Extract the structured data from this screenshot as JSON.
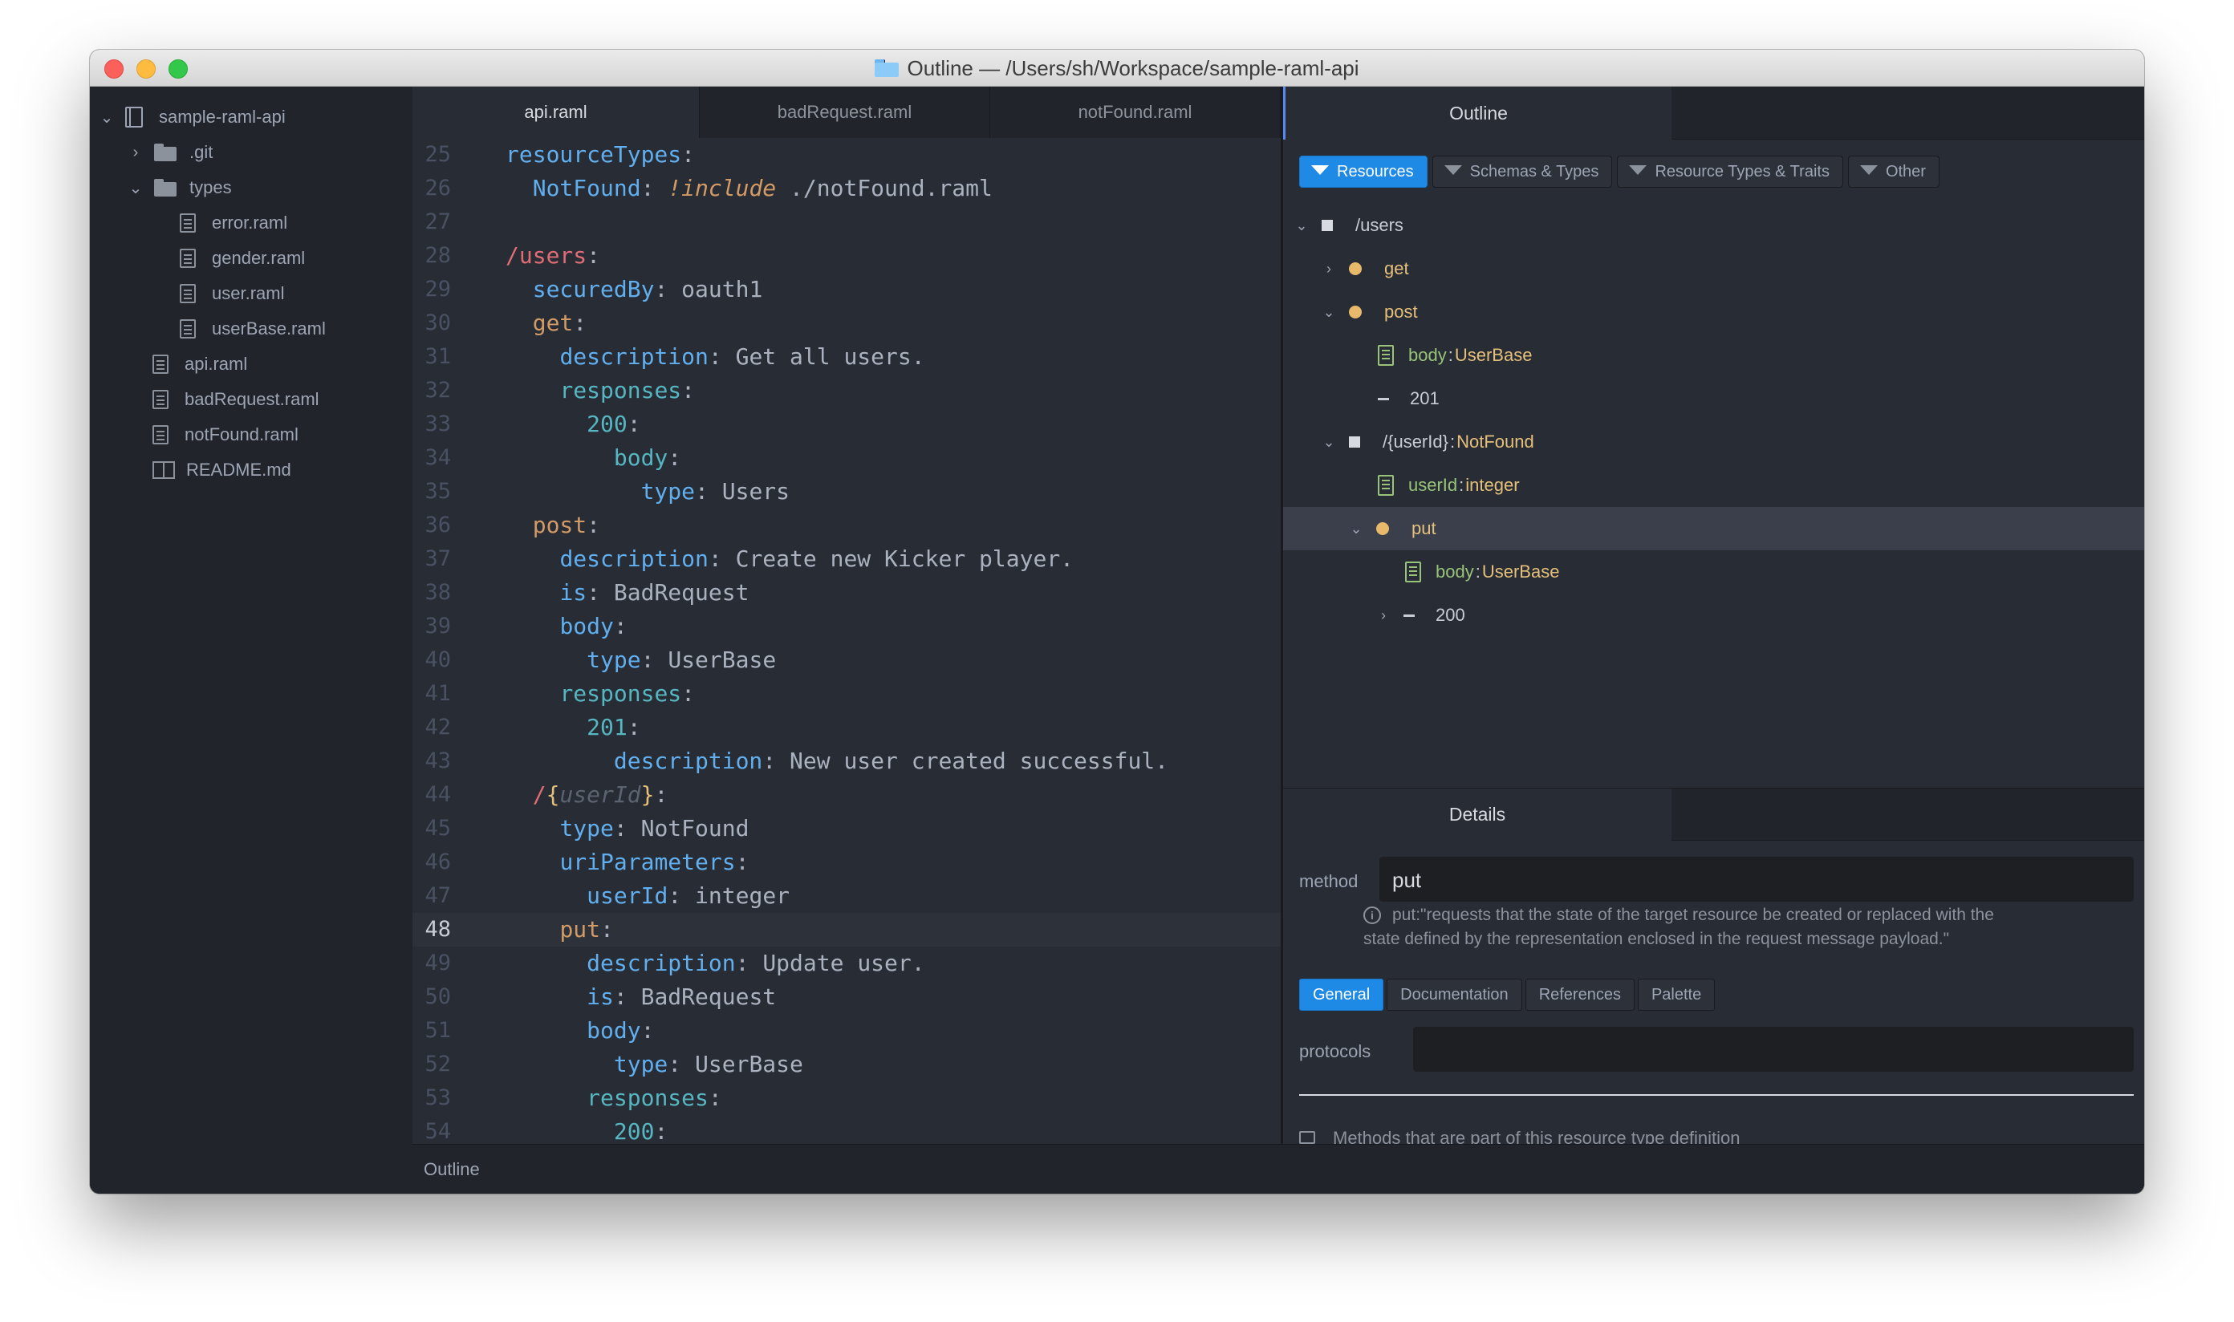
{
  "window": {
    "title": "Outline — /Users/sh/Workspace/sample-raml-api"
  },
  "sidebar": {
    "root": "sample-raml-api",
    "items": [
      {
        "label": ".git",
        "kind": "folder",
        "expanded": false
      },
      {
        "label": "types",
        "kind": "folder",
        "expanded": true
      },
      {
        "label": "error.raml",
        "kind": "file"
      },
      {
        "label": "gender.raml",
        "kind": "file"
      },
      {
        "label": "user.raml",
        "kind": "file"
      },
      {
        "label": "userBase.raml",
        "kind": "file"
      },
      {
        "label": "api.raml",
        "kind": "file"
      },
      {
        "label": "badRequest.raml",
        "kind": "file"
      },
      {
        "label": "notFound.raml",
        "kind": "file"
      },
      {
        "label": "README.md",
        "kind": "book"
      }
    ]
  },
  "editor": {
    "tabs": [
      "api.raml",
      "badRequest.raml",
      "notFound.raml"
    ],
    "active_tab": "api.raml",
    "current_line": "48",
    "line_numbers": [
      "25",
      "26",
      "27",
      "28",
      "29",
      "30",
      "31",
      "32",
      "33",
      "34",
      "35",
      "36",
      "37",
      "38",
      "39",
      "40",
      "41",
      "42",
      "43",
      "44",
      "45",
      "46",
      "47",
      "48",
      "49",
      "50",
      "51",
      "52",
      "53",
      "54"
    ],
    "lines": {
      "l25": {
        "key": "resourceTypes"
      },
      "l26": {
        "key": "NotFound",
        "tag": "!include",
        "value": "./notFound.raml"
      },
      "l28": {
        "key": "/users"
      },
      "l29": {
        "key": "securedBy",
        "value": "oauth1"
      },
      "l30": {
        "key": "get"
      },
      "l31": {
        "key": "description",
        "value": "Get all users."
      },
      "l32": {
        "key": "responses"
      },
      "l33": {
        "key": "200"
      },
      "l34": {
        "key": "body"
      },
      "l35": {
        "key": "type",
        "value": "Users"
      },
      "l36": {
        "key": "post"
      },
      "l37": {
        "key": "description",
        "value": "Create new Kicker player."
      },
      "l38": {
        "key": "is",
        "value": "BadRequest"
      },
      "l39": {
        "key": "body"
      },
      "l40": {
        "key": "type",
        "value": "UserBase"
      },
      "l41": {
        "key": "responses"
      },
      "l42": {
        "key": "201"
      },
      "l43": {
        "key": "description",
        "value": "New user created successful."
      },
      "l44": {
        "slash": "/",
        "open": "{",
        "param": "userId",
        "close": "}"
      },
      "l45": {
        "key": "type",
        "value": "NotFound"
      },
      "l46": {
        "key": "uriParameters"
      },
      "l47": {
        "key": "userId",
        "value": "integer"
      },
      "l48": {
        "key": "put"
      },
      "l49": {
        "key": "description",
        "value": "Update user."
      },
      "l50": {
        "key": "is",
        "value": "BadRequest"
      },
      "l51": {
        "key": "body"
      },
      "l52": {
        "key": "type",
        "value": "UserBase"
      },
      "l53": {
        "key": "responses"
      },
      "l54": {
        "key": "200"
      }
    }
  },
  "status_bar": {
    "left_text": "Outline"
  },
  "outline": {
    "tab_label": "Outline",
    "filters": [
      "Resources",
      "Schemas & Types",
      "Resource Types & Traits",
      "Other"
    ],
    "active_filter": "Resources",
    "rows": [
      {
        "label": "/users"
      },
      {
        "label": "get"
      },
      {
        "label": "post"
      },
      {
        "label": "body",
        "sep": ":",
        "type": "UserBase"
      },
      {
        "label": "201"
      },
      {
        "label": "/{userId}",
        "sep": ":",
        "type": "NotFound"
      },
      {
        "label": "userId",
        "sep": ":",
        "type": "integer"
      },
      {
        "label": "put"
      },
      {
        "label": "body",
        "sep": ":",
        "type": "UserBase"
      },
      {
        "label": "200"
      }
    ]
  },
  "details": {
    "tab_label": "Details",
    "method_label": "method",
    "method_value": "put",
    "info_text_1": "put:\"requests that the state of the target resource be created or replaced with the",
    "info_text_2": "state defined by the representation enclosed in the request message payload.\"",
    "tabs": [
      "General",
      "Documentation",
      "References",
      "Palette"
    ],
    "active_tab": "General",
    "protocols_label": "protocols",
    "protocols_value": "",
    "checkbox_label": "Methods that are part of this resource type definition",
    "checkbox_checked": false
  },
  "colors": {
    "accent": "#1e8ae6",
    "key_blue": "#61afef",
    "key_cyan": "#56b6c2",
    "key_red": "#e06c75",
    "method_orange": "#d19a66",
    "type_yellow": "#e5c07b",
    "body_green": "#98c379"
  }
}
